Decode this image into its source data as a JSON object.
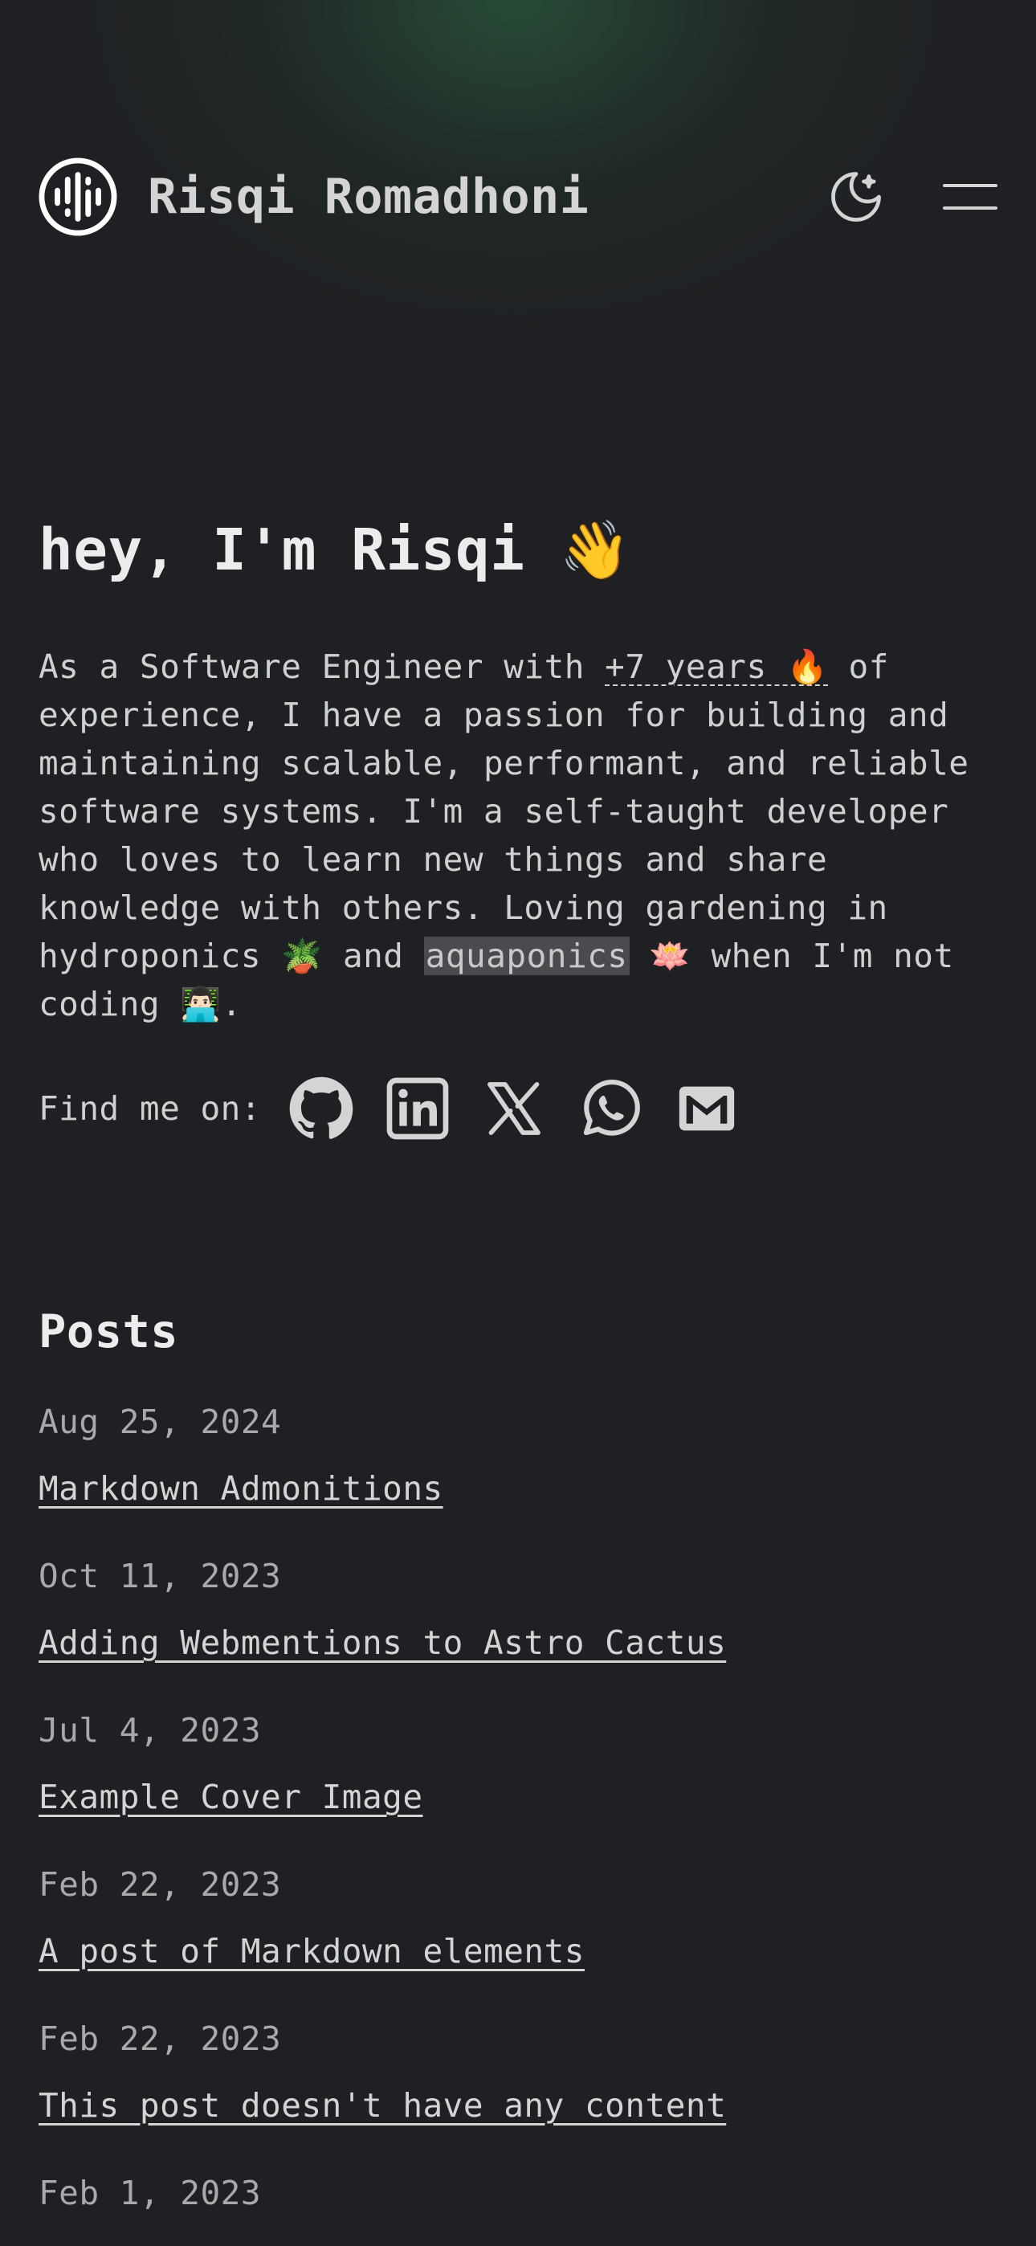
{
  "header": {
    "site_name": "Risqi Romadhoni",
    "theme_toggle_icon": "moon-icon",
    "menu_icon": "hamburger-menu-icon"
  },
  "hero": {
    "title": "hey, I'm Risqi 👋",
    "bio": {
      "part1": "As a Software Engineer with ",
      "years": "+7 years 🔥",
      "part2": " of experience, I have a passion for building and maintaining scalable, performant, and reliable software systems. I'm a self-taught developer who loves to learn new things and share knowledge with others. Loving gardening in hydroponics 🪴 and ",
      "highlight": "aquaponics",
      "part3": " 🪷 when I'm not coding 👨🏻‍💻."
    }
  },
  "social": {
    "label": "Find me on:",
    "links": [
      {
        "icon": "github-icon"
      },
      {
        "icon": "linkedin-icon"
      },
      {
        "icon": "x-twitter-icon"
      },
      {
        "icon": "whatsapp-icon"
      },
      {
        "icon": "mail-icon"
      }
    ]
  },
  "posts": {
    "title": "Posts",
    "items": [
      {
        "date": "Aug 25, 2024",
        "title": "Markdown Admonitions"
      },
      {
        "date": "Oct 11, 2023",
        "title": "Adding Webmentions to Astro Cactus"
      },
      {
        "date": "Jul 4, 2023",
        "title": "Example Cover Image"
      },
      {
        "date": "Feb 22, 2023",
        "title": "A post of Markdown elements"
      },
      {
        "date": "Feb 22, 2023",
        "title": "This post doesn't have any content"
      },
      {
        "date": "Feb 1, 2023",
        "title": ""
      }
    ]
  },
  "colors": {
    "background": "#1f2023",
    "text": "#d4d4d4",
    "muted": "#a8a9ab",
    "glow": "#2e6e46"
  }
}
